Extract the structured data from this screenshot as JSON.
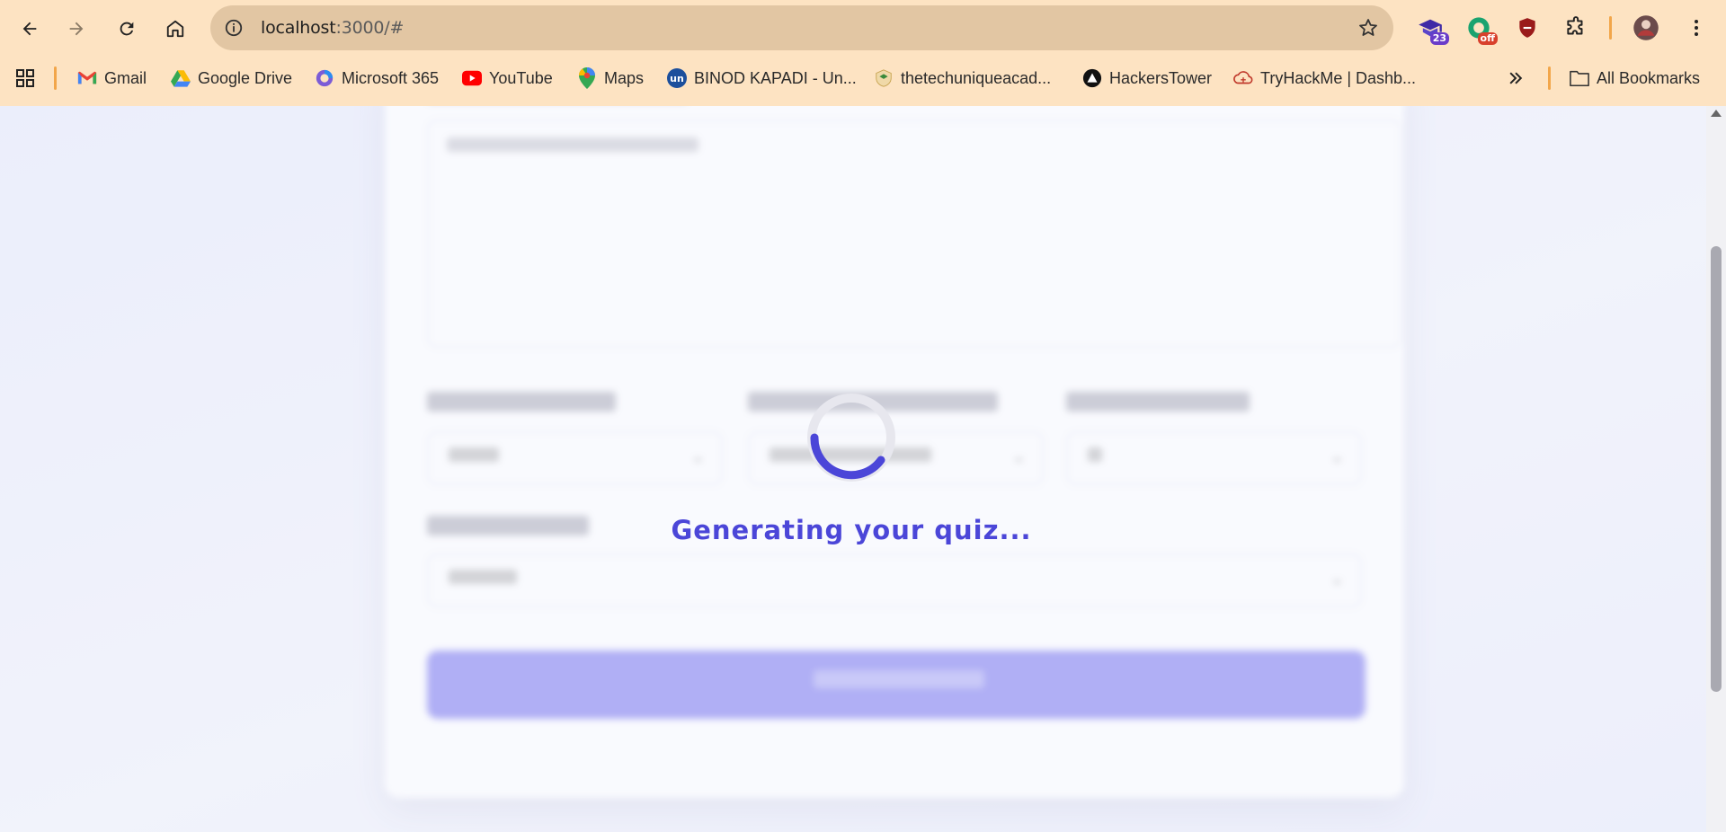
{
  "browser": {
    "url_host": "localhost",
    "url_rest": ":3000/#",
    "extensions": [
      {
        "name": "graduation-extension-icon",
        "badge": "23",
        "badge_color": "#6a3cc9"
      },
      {
        "name": "grammar-extension-icon",
        "badge": "off",
        "badge_color": "#d8402c"
      },
      {
        "name": "shield-extension-icon",
        "badge": ""
      }
    ]
  },
  "bookmarks": [
    {
      "label": "Gmail",
      "icon": "gmail-icon"
    },
    {
      "label": "Google Drive",
      "icon": "google-drive-icon"
    },
    {
      "label": "Microsoft 365",
      "icon": "microsoft-365-icon"
    },
    {
      "label": "YouTube",
      "icon": "youtube-icon"
    },
    {
      "label": "Maps",
      "icon": "maps-icon"
    },
    {
      "label": "BINOD KAPADI - Un...",
      "icon": "unstop-icon"
    },
    {
      "label": "thetechuniqueacad...",
      "icon": "academy-icon"
    },
    {
      "label": "HackersTower",
      "icon": "hackerstower-icon"
    },
    {
      "label": "TryHackMe | Dashb...",
      "icon": "tryhackme-icon"
    }
  ],
  "all_bookmarks_label": "All Bookmarks",
  "page": {
    "loading_text": "Generating your quiz...",
    "accent": "#4b46d8"
  }
}
